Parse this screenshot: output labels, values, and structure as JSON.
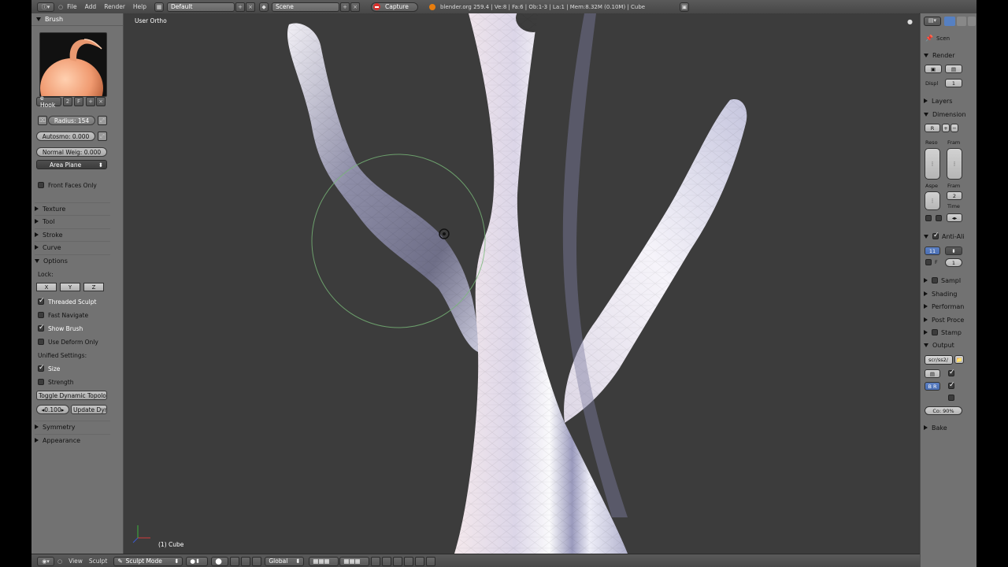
{
  "topbar": {
    "menus": [
      "File",
      "Add",
      "Render",
      "Help"
    ],
    "screen_layout": "Default",
    "scene": "Scene",
    "capture_label": "Capture",
    "stats": "blender.org 259.4 | Ve:8 | Fa:6 | Ob:1-3 | La:1 | Mem:8.32M (0.10M) | Cube"
  },
  "tool_panel": {
    "brush_header": "Brush",
    "brush_name": "e Hook",
    "brush_users": "2",
    "brush_fake": "F",
    "radius": "Radius: 154",
    "autosmooth": "Autosmo: 0.000",
    "normal_weight": "Normal Weig: 0.000",
    "area_plane": "Area Plane",
    "front_faces_only": "Front Faces Only",
    "sections": [
      "Texture",
      "Tool",
      "Stroke",
      "Curve"
    ],
    "options_header": "Options",
    "lock_label": "Lock:",
    "lock_axes": [
      "X",
      "Y",
      "Z"
    ],
    "threaded_sculpt": "Threaded Sculpt",
    "fast_navigate": "Fast Navigate",
    "show_brush": "Show Brush",
    "use_deform_only": "Use Deform Only",
    "unified_settings": "Unified Settings:",
    "size": "Size",
    "strength": "Strength",
    "toggle_dynamic_topology": "Toggle Dynamic Topolog",
    "detail_size": "0.100",
    "update_dyn": "Update Dyn",
    "symmetry": "Symmetry",
    "appearance": "Appearance"
  },
  "viewport": {
    "view_label": "User Ortho",
    "object_label": "(1) Cube"
  },
  "properties": {
    "scene_tab": "Scen",
    "render_header": "Render",
    "display_label": "Displ",
    "display_value": "1",
    "layers": "Layers",
    "dimensions": "Dimension",
    "preset": "R",
    "resolution_label": "Reso",
    "frame_label": "Fram",
    "aspect_label": "Aspe",
    "frame_label_2": "Fram",
    "frame_step": "2",
    "time_label": "Time",
    "anti_aliasing": "Anti-Ali",
    "aa_samples": "11",
    "aa_filter_label": "F",
    "aa_filter_value": "1",
    "sampled_motion_blur": "Sampl",
    "shading": "Shading",
    "performance": "Performan",
    "post_processing": "Post Proce",
    "stamp": "Stamp",
    "output": "Output",
    "output_path": "scr/ss2/",
    "compression": "Co: 90%",
    "bake": "Bake"
  },
  "bottombar": {
    "menus": [
      "View",
      "Sculpt"
    ],
    "mode": "Sculpt Mode",
    "orientation": "Global"
  },
  "colors": {
    "panel_bg": "#727272",
    "viewport_bg": "#3c3c3c",
    "header_bg": "#4f4f4f",
    "brush_circle": "#7bbf7b",
    "mesh_light": "#e8e6f2",
    "mesh_shadow": "#8585a6"
  }
}
